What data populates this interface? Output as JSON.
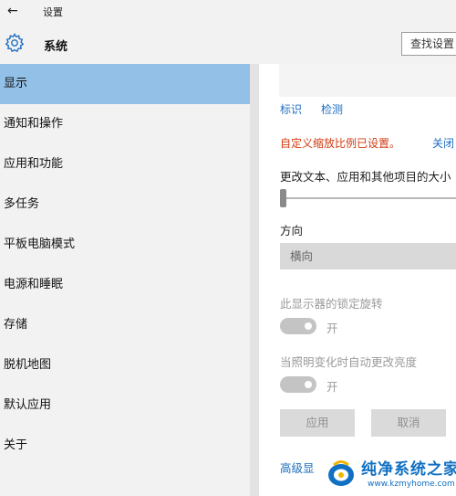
{
  "window": {
    "title": "设置"
  },
  "header": {
    "section_title": "系统",
    "search_placeholder": "查找设置"
  },
  "sidebar": {
    "items": [
      {
        "label": "显示",
        "active": true
      },
      {
        "label": "通知和操作"
      },
      {
        "label": "应用和功能"
      },
      {
        "label": "多任务"
      },
      {
        "label": "平板电脑模式"
      },
      {
        "label": "电源和睡眠"
      },
      {
        "label": "存储"
      },
      {
        "label": "脱机地图"
      },
      {
        "label": "默认应用"
      },
      {
        "label": "关于"
      }
    ]
  },
  "content": {
    "links": {
      "identify": "标识",
      "detect": "检测"
    },
    "warning": {
      "text": "自定义缩放比例已设置。",
      "link": "关闭"
    },
    "scale_label": "更改文本、应用和其他项目的大小",
    "orientation": {
      "label": "方向",
      "value": "横向"
    },
    "rotation_lock": {
      "label": "此显示器的锁定旋转",
      "state": "开"
    },
    "auto_brightness": {
      "label": "当照明变化时自动更改亮度",
      "state": "开"
    },
    "buttons": {
      "apply": "应用",
      "cancel": "取消"
    },
    "advanced_link": "高级显"
  },
  "watermark": {
    "title": "纯净系统之家",
    "url": "www.kzmyhome.com"
  },
  "colors": {
    "accent": "#92c0e6",
    "link": "#1e6fc1",
    "warning": "#d23b10"
  }
}
